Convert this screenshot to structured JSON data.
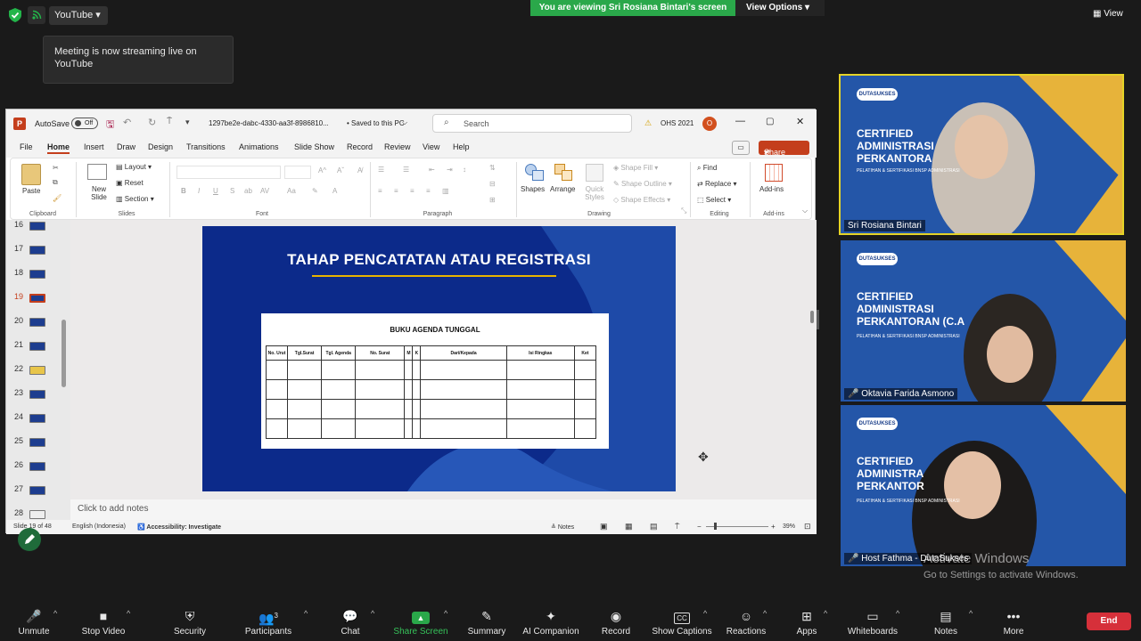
{
  "topbar": {
    "stream_label": "YouTube",
    "tooltip": "Meeting is now streaming live on YouTube",
    "viewing_banner": "You are viewing Sri Rosiana Bintari's screen",
    "view_options": "View Options",
    "view_label": "View"
  },
  "ppt": {
    "autosave": "AutoSave",
    "toggle": "Off",
    "filename": "1297be2e-dabc-4330-aa3f-8986810...",
    "saved": "• Saved to this PC",
    "search_placeholder": "Search",
    "ohs": "OHS 2021",
    "avatar_letter": "O",
    "menu": [
      "File",
      "Home",
      "Insert",
      "Draw",
      "Design",
      "Transitions",
      "Animations",
      "Slide Show",
      "Record",
      "Review",
      "View",
      "Help"
    ],
    "share": "Share",
    "ribbon": {
      "paste": "Paste",
      "clipboard": "Clipboard",
      "new_slide": "New Slide",
      "layout": "Layout",
      "reset": "Reset",
      "section": "Section",
      "slides": "Slides",
      "font": "Font",
      "paragraph": "Paragraph",
      "shapes": "Shapes",
      "arrange": "Arrange",
      "quick_styles": "Quick Styles",
      "shape_fill": "Shape Fill",
      "shape_outline": "Shape Outline",
      "shape_effects": "Shape Effects",
      "drawing": "Drawing",
      "find": "Find",
      "replace": "Replace",
      "select": "Select",
      "editing": "Editing",
      "addins": "Add-ins",
      "addins_group": "Add-ins"
    },
    "thumb_numbers": [
      "16",
      "17",
      "18",
      "19",
      "20",
      "21",
      "22",
      "23",
      "24",
      "25",
      "26",
      "27",
      "28"
    ],
    "slide": {
      "title": "TAHAP  PENCATATAN ATAU REGISTRASI",
      "table_title": "BUKU AGENDA TUNGGAL",
      "headers": [
        "No. Urut",
        "Tgl.Surat",
        "Tgl. Agenda",
        "No. Surat",
        "M",
        "K",
        "Dari/Kepada",
        "Isi Ringkas",
        "Ket"
      ]
    },
    "notes_placeholder": "Click to add notes",
    "status": {
      "slide_of": "Slide 19 of 48",
      "language": "English (Indonesia)",
      "accessibility": "Accessibility: Investigate",
      "notes": "Notes",
      "zoom": "39%"
    }
  },
  "participants": [
    {
      "name": "Sri Rosiana Bintari",
      "overlay": "CERTIFIED\nADMINISTRASI\nPERKANTORA"
    },
    {
      "name": "Oktavia Farida Asmono",
      "overlay": "CERTIFIED\nADMINISTRASI\nPERKANTORAN (C.A"
    },
    {
      "name": "Host Fathma - DutaSukses",
      "overlay": "CERTIFIED\nADMINISTRA\nPERKANTOR"
    }
  ],
  "tile_sub": "PELATIHAN & SERTIFIKASI BNSP ADMINISTRASI",
  "logo_text": "DUTASUKSES",
  "windows": {
    "line1": "Activate Windows",
    "line2": "Go to Settings to activate Windows."
  },
  "toolbar": [
    {
      "label": "Unmute",
      "icon": "mic-muted-icon",
      "glyph": "🎤"
    },
    {
      "label": "Stop Video",
      "icon": "video-icon",
      "glyph": "■"
    },
    {
      "label": "Security",
      "icon": "shield-icon",
      "glyph": "⛨"
    },
    {
      "label": "Participants",
      "icon": "participants-icon",
      "glyph": "👥",
      "count": "3"
    },
    {
      "label": "Chat",
      "icon": "chat-icon",
      "glyph": "💬"
    },
    {
      "label": "Share Screen",
      "icon": "share-screen-icon",
      "glyph": "▲"
    },
    {
      "label": "Summary",
      "icon": "summary-icon",
      "glyph": "✎"
    },
    {
      "label": "AI Companion",
      "icon": "sparkle-icon",
      "glyph": "✦"
    },
    {
      "label": "Record",
      "icon": "record-icon",
      "glyph": "◉"
    },
    {
      "label": "Show Captions",
      "icon": "captions-icon",
      "glyph": "CC"
    },
    {
      "label": "Reactions",
      "icon": "reactions-icon",
      "glyph": "☺"
    },
    {
      "label": "Apps",
      "icon": "apps-icon",
      "glyph": "⊞"
    },
    {
      "label": "Whiteboards",
      "icon": "whiteboard-icon",
      "glyph": "▭"
    },
    {
      "label": "Notes",
      "icon": "notes-icon",
      "glyph": "▤"
    },
    {
      "label": "More",
      "icon": "more-icon",
      "glyph": "•••"
    }
  ],
  "end_label": "End",
  "colors": {
    "accent_green": "#2aa84a",
    "end_red": "#d6303a",
    "ppt_red": "#c43e1c",
    "slide_blue": "#0c2a8a",
    "title_underline": "#e8b400"
  }
}
